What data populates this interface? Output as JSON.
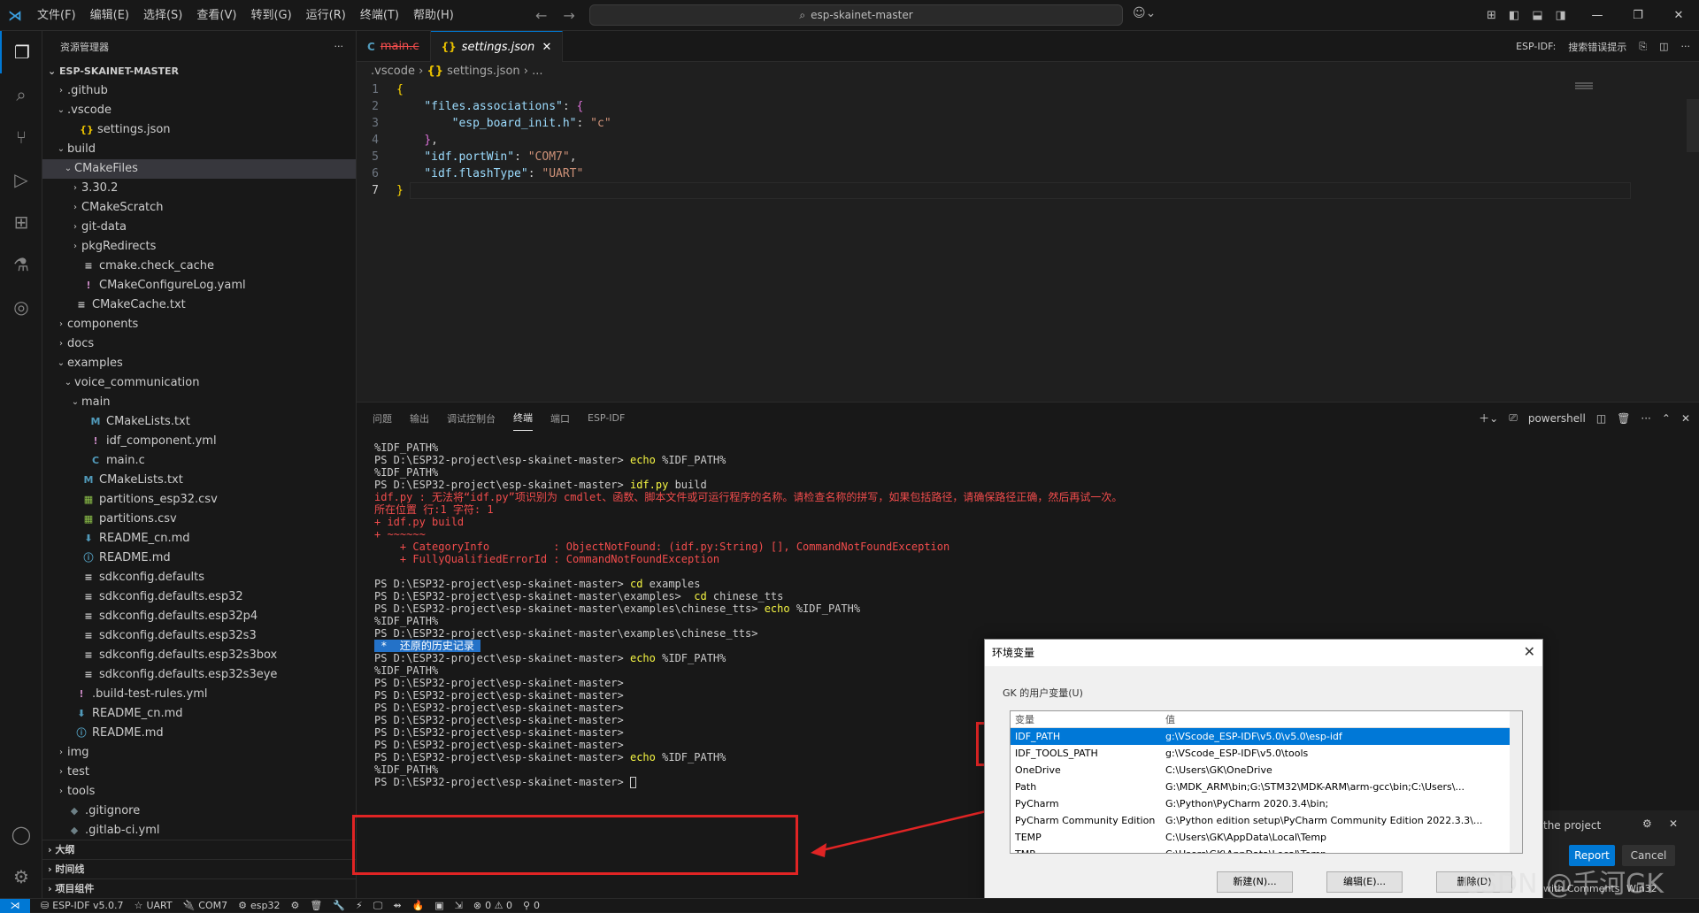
{
  "menu": [
    "文件(F)",
    "编辑(E)",
    "选择(S)",
    "查看(V)",
    "转到(G)",
    "运行(R)",
    "终端(T)",
    "帮助(H)"
  ],
  "search": {
    "text": "esp-skainet-master"
  },
  "sidebar": {
    "title": "资源管理器",
    "root": "ESP-SKAINET-MASTER",
    "items": [
      {
        "label": ".github",
        "chev": "›",
        "icon": "",
        "indent": 14
      },
      {
        "label": ".vscode",
        "chev": "⌄",
        "icon": "",
        "indent": 14
      },
      {
        "label": "settings.json",
        "chev": "",
        "icon": "{}",
        "indent": 28
      },
      {
        "label": "build",
        "chev": "⌄",
        "icon": "",
        "indent": 14
      },
      {
        "label": "CMakeFiles",
        "chev": "⌄",
        "icon": "",
        "indent": 22
      },
      {
        "label": "3.30.2",
        "chev": "›",
        "icon": "",
        "indent": 30
      },
      {
        "label": "CMakeScratch",
        "chev": "›",
        "icon": "",
        "indent": 30
      },
      {
        "label": "git-data",
        "chev": "›",
        "icon": "",
        "indent": 30
      },
      {
        "label": "pkgRedirects",
        "chev": "›",
        "icon": "",
        "indent": 30
      },
      {
        "label": "cmake.check_cache",
        "chev": "",
        "icon": "≡",
        "indent": 30
      },
      {
        "label": "CMakeConfigureLog.yaml",
        "chev": "",
        "icon": "!",
        "indent": 30
      },
      {
        "label": "CMakeCache.txt",
        "chev": "",
        "icon": "≡",
        "indent": 22
      },
      {
        "label": "components",
        "chev": "›",
        "icon": "",
        "indent": 14
      },
      {
        "label": "docs",
        "chev": "›",
        "icon": "",
        "indent": 14
      },
      {
        "label": "examples",
        "chev": "⌄",
        "icon": "",
        "indent": 14
      },
      {
        "label": "voice_communication",
        "chev": "⌄",
        "icon": "",
        "indent": 22
      },
      {
        "label": "main",
        "chev": "⌄",
        "icon": "",
        "indent": 30
      },
      {
        "label": "CMakeLists.txt",
        "chev": "",
        "icon": "M",
        "indent": 38
      },
      {
        "label": "idf_component.yml",
        "chev": "",
        "icon": "!",
        "indent": 38
      },
      {
        "label": "main.c",
        "chev": "",
        "icon": "C",
        "indent": 38
      },
      {
        "label": "CMakeLists.txt",
        "chev": "",
        "icon": "M",
        "indent": 30
      },
      {
        "label": "partitions_esp32.csv",
        "chev": "",
        "icon": "▦",
        "indent": 30
      },
      {
        "label": "partitions.csv",
        "chev": "",
        "icon": "▦",
        "indent": 30
      },
      {
        "label": "README_cn.md",
        "chev": "",
        "icon": "⬇",
        "indent": 30
      },
      {
        "label": "README.md",
        "chev": "",
        "icon": "ⓘ",
        "indent": 30
      },
      {
        "label": "sdkconfig.defaults",
        "chev": "",
        "icon": "≡",
        "indent": 30
      },
      {
        "label": "sdkconfig.defaults.esp32",
        "chev": "",
        "icon": "≡",
        "indent": 30
      },
      {
        "label": "sdkconfig.defaults.esp32p4",
        "chev": "",
        "icon": "≡",
        "indent": 30
      },
      {
        "label": "sdkconfig.defaults.esp32s3",
        "chev": "",
        "icon": "≡",
        "indent": 30
      },
      {
        "label": "sdkconfig.defaults.esp32s3box",
        "chev": "",
        "icon": "≡",
        "indent": 30
      },
      {
        "label": "sdkconfig.defaults.esp32s3eye",
        "chev": "",
        "icon": "≡",
        "indent": 30
      },
      {
        "label": ".build-test-rules.yml",
        "chev": "",
        "icon": "!",
        "indent": 22
      },
      {
        "label": "README_cn.md",
        "chev": "",
        "icon": "⬇",
        "indent": 22
      },
      {
        "label": "README.md",
        "chev": "",
        "icon": "ⓘ",
        "indent": 22
      },
      {
        "label": "img",
        "chev": "›",
        "icon": "",
        "indent": 14
      },
      {
        "label": "test",
        "chev": "›",
        "icon": "",
        "indent": 14
      },
      {
        "label": "tools",
        "chev": "›",
        "icon": "",
        "indent": 14
      },
      {
        "label": ".gitignore",
        "chev": "",
        "icon": "◆",
        "indent": 14
      },
      {
        "label": ".gitlab-ci.yml",
        "chev": "",
        "icon": "◆",
        "indent": 14
      }
    ],
    "sections": [
      "大纲",
      "时间线",
      "项目组件"
    ]
  },
  "tabs": [
    {
      "icon": "C",
      "label": "main.c",
      "active": false
    },
    {
      "icon": "{}",
      "label": "settings.json",
      "active": true
    }
  ],
  "tab_right": {
    "label": "ESP-IDF:",
    "action": "搜索错误提示"
  },
  "breadcrumb": {
    "folder": ".vscode",
    "file": "settings.json",
    "more": "..."
  },
  "code_lines": [
    {
      "n": "1",
      "t": [
        [
          "p",
          "{"
        ]
      ]
    },
    {
      "n": "2",
      "t": [
        [
          "w",
          "    "
        ],
        [
          "k",
          "\"files.associations\""
        ],
        [
          "w",
          ": "
        ],
        [
          "pu",
          "{"
        ]
      ]
    },
    {
      "n": "3",
      "t": [
        [
          "w",
          "        "
        ],
        [
          "k",
          "\"esp_board_init.h\""
        ],
        [
          "w",
          ": "
        ],
        [
          "s",
          "\"c\""
        ]
      ]
    },
    {
      "n": "4",
      "t": [
        [
          "w",
          "    "
        ],
        [
          "pu",
          "}"
        ],
        [
          "w",
          ","
        ]
      ]
    },
    {
      "n": "5",
      "t": [
        [
          "w",
          "    "
        ],
        [
          "k",
          "\"idf.portWin\""
        ],
        [
          "w",
          ": "
        ],
        [
          "s",
          "\"COM7\""
        ],
        [
          "w",
          ","
        ]
      ]
    },
    {
      "n": "6",
      "t": [
        [
          "w",
          "    "
        ],
        [
          "k",
          "\"idf.flashType\""
        ],
        [
          "w",
          ": "
        ],
        [
          "s",
          "\"UART\""
        ]
      ]
    },
    {
      "n": "7",
      "t": [
        [
          "p",
          "}"
        ]
      ]
    }
  ],
  "panel_tabs": [
    "问题",
    "输出",
    "调试控制台",
    "终端",
    "端口",
    "ESP-IDF"
  ],
  "panel_shell": "powershell",
  "terminal": [
    [
      [
        "n",
        "%IDF_PATH%"
      ]
    ],
    [
      [
        "n",
        "PS D:\\ESP32-project\\esp-skainet-master> "
      ],
      [
        "y",
        "echo"
      ],
      [
        "n",
        " %IDF_PATH%"
      ]
    ],
    [
      [
        "n",
        "%IDF_PATH%"
      ]
    ],
    [
      [
        "n",
        "PS D:\\ESP32-project\\esp-skainet-master> "
      ],
      [
        "y",
        "idf.py"
      ],
      [
        "n",
        " build"
      ]
    ],
    [
      [
        "r",
        "idf.py : 无法将“idf.py”项识别为 cmdlet、函数、脚本文件或可运行程序的名称。请检查名称的拼写，如果包括路径，请确保路径正确，然后再试一次。"
      ]
    ],
    [
      [
        "r",
        "所在位置 行:1 字符: 1"
      ]
    ],
    [
      [
        "r",
        "+ idf.py build"
      ]
    ],
    [
      [
        "r",
        "+ ~~~~~~"
      ]
    ],
    [
      [
        "r",
        "    + CategoryInfo          : ObjectNotFound: (idf.py:String) [], CommandNotFoundException"
      ]
    ],
    [
      [
        "r",
        "    + FullyQualifiedErrorId : CommandNotFoundException"
      ]
    ],
    [
      [
        "n",
        " "
      ]
    ],
    [
      [
        "n",
        "PS D:\\ESP32-project\\esp-skainet-master> "
      ],
      [
        "y",
        "cd"
      ],
      [
        "n",
        " examples"
      ]
    ],
    [
      [
        "n",
        "PS D:\\ESP32-project\\esp-skainet-master\\examples>  "
      ],
      [
        "y",
        "cd"
      ],
      [
        "n",
        " chinese_tts"
      ]
    ],
    [
      [
        "n",
        "PS D:\\ESP32-project\\esp-skainet-master\\examples\\chinese_tts> "
      ],
      [
        "y",
        "echo"
      ],
      [
        "n",
        " %IDF_PATH%"
      ]
    ],
    [
      [
        "n",
        "%IDF_PATH%"
      ]
    ],
    [
      [
        "n",
        "PS D:\\ESP32-project\\esp-skainet-master\\examples\\chinese_tts>"
      ]
    ],
    [
      [
        "h",
        " *  还原的历史记录 "
      ]
    ],
    [
      [
        "n",
        "PS D:\\ESP32-project\\esp-skainet-master> "
      ],
      [
        "y",
        "echo"
      ],
      [
        "n",
        " %IDF_PATH%"
      ]
    ],
    [
      [
        "n",
        "%IDF_PATH%"
      ]
    ],
    [
      [
        "n",
        "PS D:\\ESP32-project\\esp-skainet-master>"
      ]
    ],
    [
      [
        "n",
        "PS D:\\ESP32-project\\esp-skainet-master>"
      ]
    ],
    [
      [
        "n",
        "PS D:\\ESP32-project\\esp-skainet-master>"
      ]
    ],
    [
      [
        "n",
        "PS D:\\ESP32-project\\esp-skainet-master>"
      ]
    ],
    [
      [
        "n",
        "PS D:\\ESP32-project\\esp-skainet-master>"
      ]
    ],
    [
      [
        "n",
        "PS D:\\ESP32-project\\esp-skainet-master>"
      ]
    ],
    [
      [
        "n",
        "PS D:\\ESP32-project\\esp-skainet-master> "
      ],
      [
        "y",
        "echo"
      ],
      [
        "n",
        " %IDF_PATH%"
      ]
    ],
    [
      [
        "n",
        "%IDF_PATH%"
      ]
    ],
    [
      [
        "n",
        "PS D:\\ESP32-project\\esp-skainet-master> "
      ],
      [
        "c",
        ""
      ]
    ]
  ],
  "dialog": {
    "title": "环境变量",
    "group": "GK 的用户变量(U)",
    "header": [
      "变量",
      "值"
    ],
    "rows": [
      [
        "IDF_PATH",
        "g:\\VScode_ESP-IDF\\v5.0\\v5.0\\esp-idf"
      ],
      [
        "IDF_TOOLS_PATH",
        "g:\\VScode_ESP-IDF\\v5.0\\tools"
      ],
      [
        "OneDrive",
        "C:\\Users\\GK\\OneDrive"
      ],
      [
        "Path",
        "G:\\MDK_ARM\\bin;G:\\STM32\\MDK-ARM\\arm-gcc\\bin;C:\\Users\\..."
      ],
      [
        "PyCharm",
        "G:\\Python\\PyCharm 2020.3.4\\bin;"
      ],
      [
        "PyCharm Community Edition",
        "G:\\Python edition setup\\PyCharm Community Edition 2022.3.3\\..."
      ],
      [
        "TEMP",
        "C:\\Users\\GK\\AppData\\Local\\Temp"
      ],
      [
        "TMP",
        "C:\\Users\\GK\\AppData\\Local\\Temp"
      ]
    ],
    "buttons": [
      "新建(N)...",
      "编辑(E)...",
      "删除(D)"
    ]
  },
  "notification": {
    "text": "the project",
    "report": "Report",
    "cancel": "Cancel",
    "footer1": "with Comments",
    "footer2": "Win32"
  },
  "statusbar": [
    {
      "icon": "⛁",
      "label": "ESP-IDF v5.0.7"
    },
    {
      "icon": "☆",
      "label": "UART"
    },
    {
      "icon": "🔌",
      "label": "COM7"
    },
    {
      "icon": "⚙",
      "label": "esp32"
    },
    {
      "icon": "⚙",
      "label": ""
    },
    {
      "icon": "🗑",
      "label": ""
    },
    {
      "icon": "🔧",
      "label": ""
    },
    {
      "icon": "⚡",
      "label": ""
    },
    {
      "icon": "🖵",
      "label": ""
    },
    {
      "icon": "⇴",
      "label": ""
    },
    {
      "icon": "🔥",
      "label": ""
    },
    {
      "icon": "▣",
      "label": ""
    },
    {
      "icon": "⇲",
      "label": ""
    },
    {
      "icon": "⊗",
      "label": "0 ⚠ 0"
    },
    {
      "icon": "⚲",
      "label": "0"
    }
  ],
  "watermark": "CSDN @千河GK"
}
